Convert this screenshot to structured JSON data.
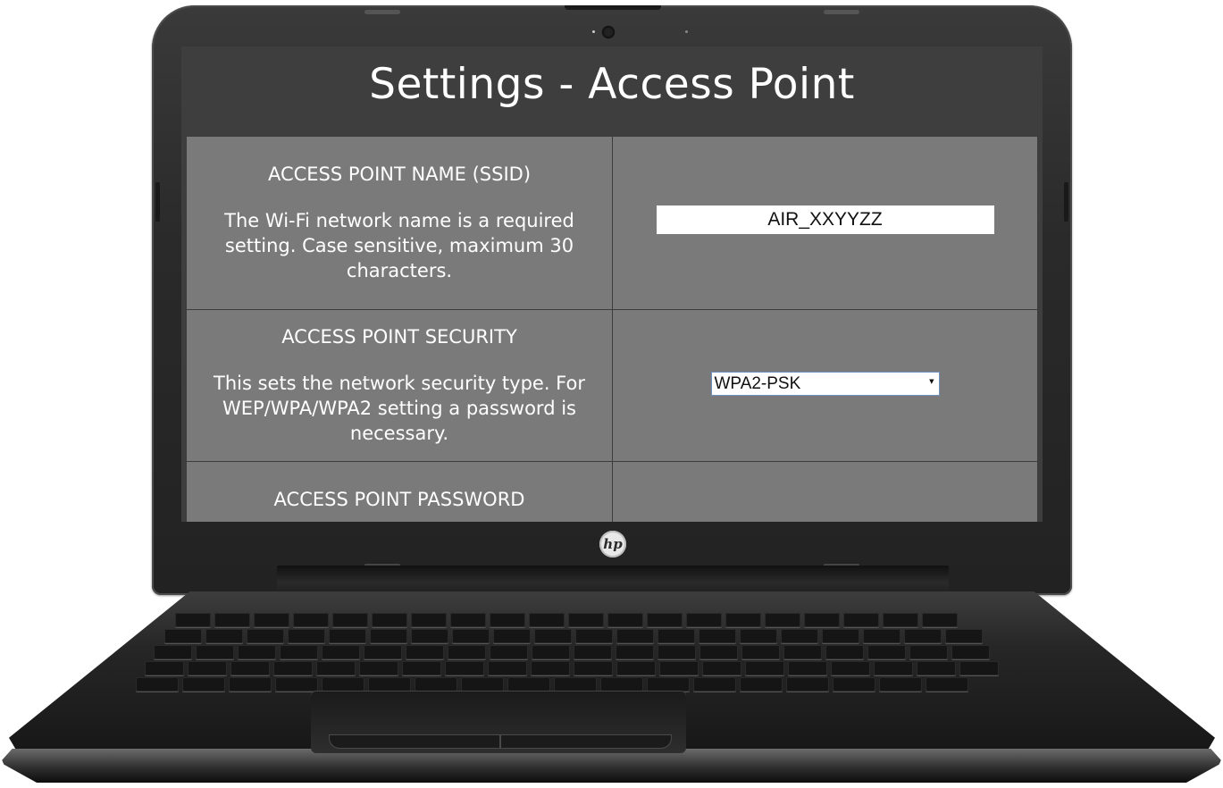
{
  "page": {
    "title": "Settings - Access Point"
  },
  "settings": [
    {
      "name": "ACCESS POINT NAME (SSID)",
      "description": "The Wi-Fi network name is a required setting. Case sensitive, maximum 30 characters.",
      "value": "AIR_XXYYZZ"
    },
    {
      "name": "ACCESS POINT SECURITY",
      "description": "This sets the network security type. For WEP/WPA/WPA2 setting a password is necessary.",
      "selected": "WPA2-PSK"
    },
    {
      "name": "ACCESS POINT PASSWORD"
    }
  ],
  "device": {
    "brand_logo": "hp",
    "webcam_icon": "webcam-icon"
  }
}
